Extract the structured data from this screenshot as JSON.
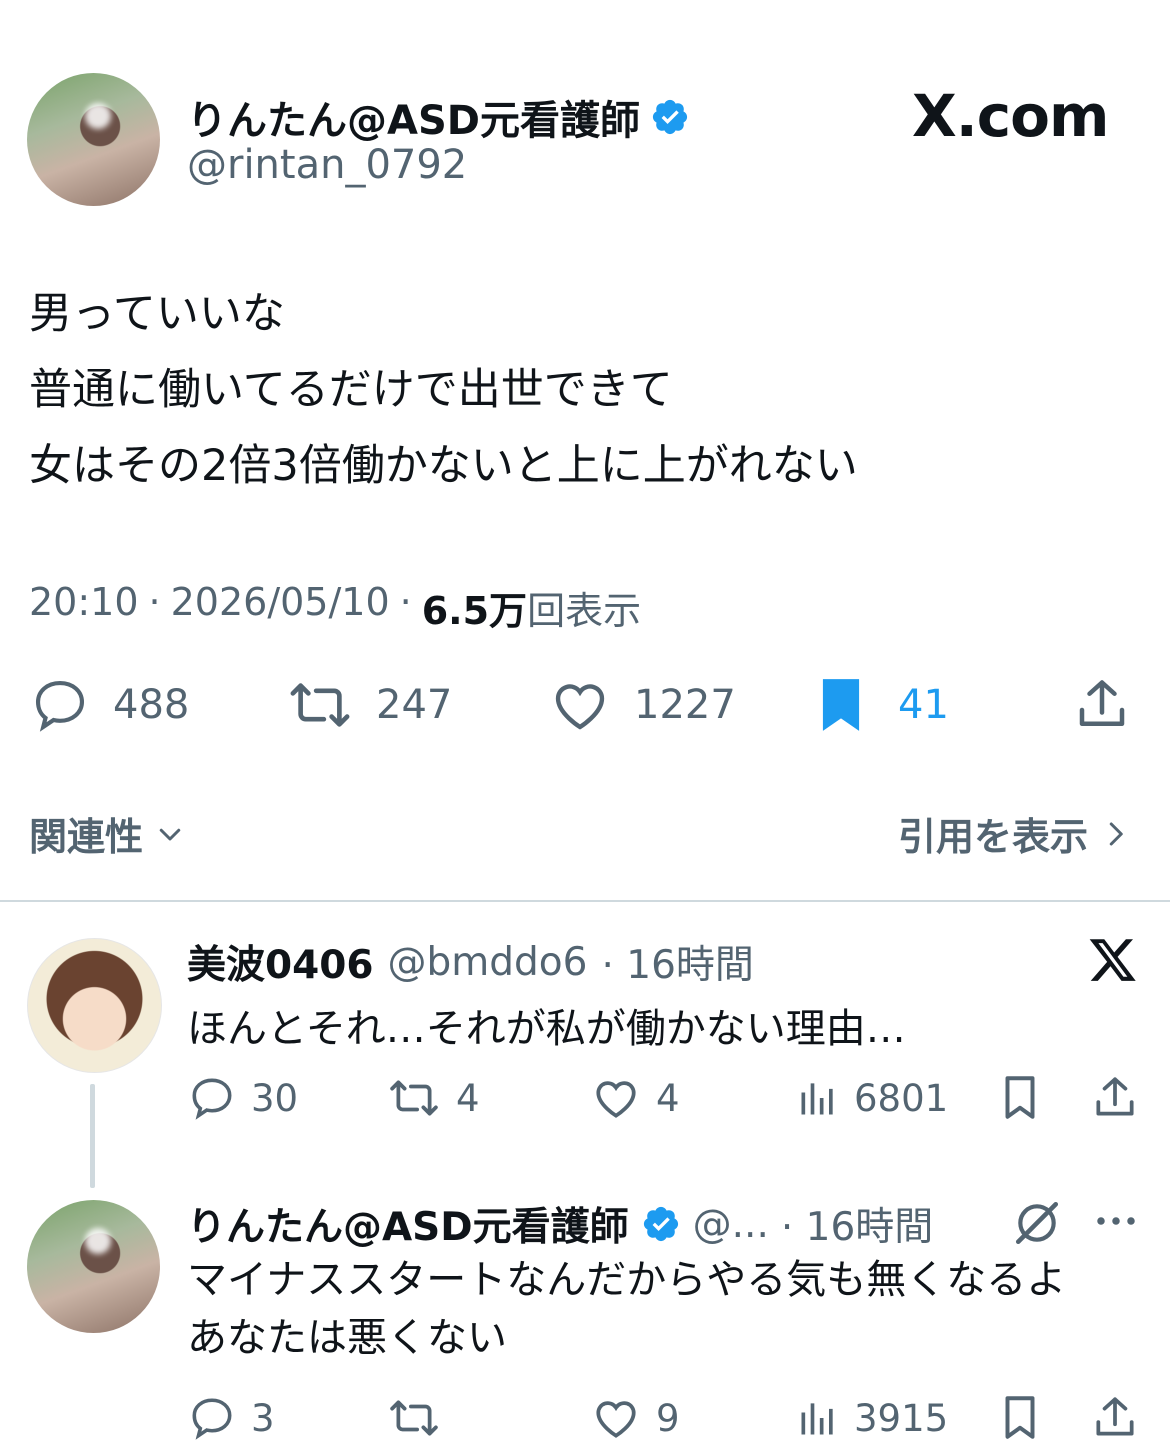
{
  "main_tweet": {
    "display_name": "りんたん@ASD元看護師",
    "handle": "@rintan_0792",
    "brand": "X.com",
    "lines": [
      "男っていいな",
      "普通に働いてるだけで出世できて",
      "女はその2倍3倍働かないと上に上がれない"
    ],
    "time": "20:10",
    "date": "2026/05/10",
    "views_number": "6.5万",
    "views_suffix": "回表示",
    "sep": "·",
    "stats": {
      "replies": "488",
      "retweets": "247",
      "likes": "1227",
      "bookmarks": "41"
    },
    "relevance_label": "関連性",
    "quotes_label": "引用を表示"
  },
  "replies": [
    {
      "display_name": "美波0406",
      "handle": "@bmddo6",
      "time": "· 16時間",
      "text": "ほんとそれ…それが私が働かない理由…",
      "stats": {
        "replies": "30",
        "retweets": "4",
        "likes": "4",
        "views": "6801"
      }
    },
    {
      "display_name": "りんたん@ASD元看護師",
      "handle": "@...",
      "time": "· 16時間",
      "lines": [
        "マイナススタートなんだからやる気も無くなるよ",
        "あなたは悪くない"
      ],
      "stats": {
        "replies": "3",
        "retweets": "",
        "likes": "9",
        "views": "3915"
      }
    }
  ],
  "colors": {
    "text": "#0f1419",
    "secondary": "#536471",
    "accent": "#1d9bf0",
    "divider": "#cfd9de"
  }
}
